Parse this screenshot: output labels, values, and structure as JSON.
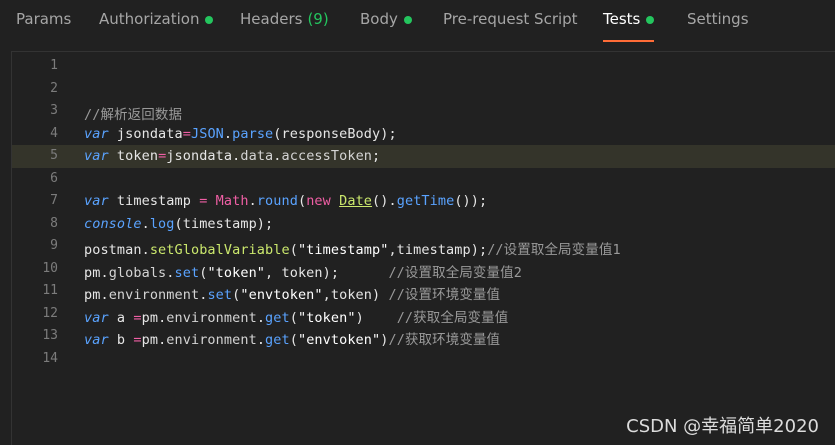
{
  "colors": {
    "active_dot": "#24c55e",
    "active_underline": "#ff6c37",
    "comment": "#9a9a9a",
    "keyword": "#5aa3ff",
    "string": "#ffffff",
    "method": "#cbe86d",
    "property": "#d4d4d4",
    "builtin": "#f05fa5",
    "operator": "#f05fa5"
  },
  "tabs": [
    {
      "label": "Params",
      "count": "",
      "dot": false,
      "active": false
    },
    {
      "label": "Authorization",
      "count": "",
      "dot": true,
      "active": false
    },
    {
      "label": "Headers",
      "count": "(9)",
      "dot": false,
      "active": false
    },
    {
      "label": "Body",
      "count": "",
      "dot": true,
      "active": false
    },
    {
      "label": "Pre-request Script",
      "count": "",
      "dot": false,
      "active": false
    },
    {
      "label": "Tests",
      "count": "",
      "dot": true,
      "active": true
    },
    {
      "label": "Settings",
      "count": "",
      "dot": false,
      "active": false
    }
  ],
  "editor": {
    "lines": [
      {
        "num": "1",
        "highlighted": false,
        "tokens": []
      },
      {
        "num": "2",
        "highlighted": false,
        "tokens": []
      },
      {
        "num": "3",
        "highlighted": false,
        "tokens": [
          {
            "t": "//解析返回数据",
            "c": "#9a9a9a"
          }
        ]
      },
      {
        "num": "4",
        "highlighted": false,
        "tokens": [
          {
            "t": "var",
            "c": "#5aa3ff",
            "k": "kw"
          },
          {
            "t": " jsondata",
            "c": "#e6e6e6"
          },
          {
            "t": "=",
            "c": "#f05fa5"
          },
          {
            "t": "JSON",
            "c": "#5aa3ff"
          },
          {
            "t": ".",
            "c": "#e6e6e6"
          },
          {
            "t": "parse",
            "c": "#5aa3ff"
          },
          {
            "t": "(responseBody);",
            "c": "#e6e6e6"
          }
        ]
      },
      {
        "num": "5",
        "highlighted": true,
        "tokens": [
          {
            "t": "var",
            "c": "#5aa3ff",
            "k": "kw"
          },
          {
            "t": " token",
            "c": "#e6e6e6"
          },
          {
            "t": "=",
            "c": "#f05fa5"
          },
          {
            "t": "jsondata.",
            "c": "#e6e6e6"
          },
          {
            "t": "data",
            "c": "#d4d4d4"
          },
          {
            "t": ".",
            "c": "#e6e6e6"
          },
          {
            "t": "accessToken",
            "c": "#d4d4d4"
          },
          {
            "t": ";",
            "c": "#e6e6e6"
          }
        ]
      },
      {
        "num": "6",
        "highlighted": false,
        "tokens": []
      },
      {
        "num": "7",
        "highlighted": false,
        "tokens": [
          {
            "t": "var",
            "c": "#5aa3ff",
            "k": "kw"
          },
          {
            "t": " timestamp ",
            "c": "#e6e6e6"
          },
          {
            "t": "=",
            "c": "#f05fa5"
          },
          {
            "t": " ",
            "c": "#e6e6e6"
          },
          {
            "t": "Math",
            "c": "#f05fa5"
          },
          {
            "t": ".",
            "c": "#e6e6e6"
          },
          {
            "t": "round",
            "c": "#5aa3ff"
          },
          {
            "t": "(",
            "c": "#e6e6e6"
          },
          {
            "t": "new",
            "c": "#f05fa5"
          },
          {
            "t": " ",
            "c": "#e6e6e6"
          },
          {
            "t": "Date",
            "c": "#cbe86d",
            "k": "ul"
          },
          {
            "t": "().",
            "c": "#e6e6e6"
          },
          {
            "t": "getTime",
            "c": "#5aa3ff"
          },
          {
            "t": "());",
            "c": "#e6e6e6"
          }
        ]
      },
      {
        "num": "8",
        "highlighted": false,
        "tokens": [
          {
            "t": "console",
            "c": "#5aa3ff",
            "k": "kw"
          },
          {
            "t": ".",
            "c": "#e6e6e6"
          },
          {
            "t": "log",
            "c": "#5aa3ff"
          },
          {
            "t": "(timestamp);",
            "c": "#e6e6e6"
          }
        ]
      },
      {
        "num": "9",
        "highlighted": false,
        "tokens": [
          {
            "t": "postman.",
            "c": "#e6e6e6"
          },
          {
            "t": "setGlobalVariable",
            "c": "#cbe86d"
          },
          {
            "t": "(",
            "c": "#e6e6e6"
          },
          {
            "t": "\"timestamp\"",
            "c": "#ffffff"
          },
          {
            "t": ",timestamp);",
            "c": "#e6e6e6"
          },
          {
            "t": "//设置取全局变量值1",
            "c": "#9a9a9a"
          }
        ]
      },
      {
        "num": "10",
        "highlighted": false,
        "tokens": [
          {
            "t": "pm.",
            "c": "#e6e6e6"
          },
          {
            "t": "globals",
            "c": "#d4d4d4"
          },
          {
            "t": ".",
            "c": "#e6e6e6"
          },
          {
            "t": "set",
            "c": "#5aa3ff"
          },
          {
            "t": "(",
            "c": "#e6e6e6"
          },
          {
            "t": "\"token\"",
            "c": "#ffffff"
          },
          {
            "t": ", token);      ",
            "c": "#e6e6e6"
          },
          {
            "t": "//设置取全局变量值2",
            "c": "#9a9a9a"
          }
        ]
      },
      {
        "num": "11",
        "highlighted": false,
        "tokens": [
          {
            "t": "pm.",
            "c": "#e6e6e6"
          },
          {
            "t": "environment",
            "c": "#d4d4d4"
          },
          {
            "t": ".",
            "c": "#e6e6e6"
          },
          {
            "t": "set",
            "c": "#5aa3ff"
          },
          {
            "t": "(",
            "c": "#e6e6e6"
          },
          {
            "t": "\"envtoken\"",
            "c": "#ffffff"
          },
          {
            "t": ",token) ",
            "c": "#e6e6e6"
          },
          {
            "t": "//设置环境变量值",
            "c": "#9a9a9a"
          }
        ]
      },
      {
        "num": "12",
        "highlighted": false,
        "tokens": [
          {
            "t": "var",
            "c": "#5aa3ff",
            "k": "kw"
          },
          {
            "t": " a ",
            "c": "#e6e6e6"
          },
          {
            "t": "=",
            "c": "#f05fa5"
          },
          {
            "t": "pm.",
            "c": "#e6e6e6"
          },
          {
            "t": "environment",
            "c": "#d4d4d4"
          },
          {
            "t": ".",
            "c": "#e6e6e6"
          },
          {
            "t": "get",
            "c": "#5aa3ff"
          },
          {
            "t": "(",
            "c": "#e6e6e6"
          },
          {
            "t": "\"token\"",
            "c": "#ffffff"
          },
          {
            "t": ")    ",
            "c": "#e6e6e6"
          },
          {
            "t": "//获取全局变量值",
            "c": "#9a9a9a"
          }
        ]
      },
      {
        "num": "13",
        "highlighted": false,
        "tokens": [
          {
            "t": "var",
            "c": "#5aa3ff",
            "k": "kw"
          },
          {
            "t": " b ",
            "c": "#e6e6e6"
          },
          {
            "t": "=",
            "c": "#f05fa5"
          },
          {
            "t": "pm.",
            "c": "#e6e6e6"
          },
          {
            "t": "environment",
            "c": "#d4d4d4"
          },
          {
            "t": ".",
            "c": "#e6e6e6"
          },
          {
            "t": "get",
            "c": "#5aa3ff"
          },
          {
            "t": "(",
            "c": "#e6e6e6"
          },
          {
            "t": "\"envtoken\"",
            "c": "#ffffff"
          },
          {
            "t": ")",
            "c": "#e6e6e6"
          },
          {
            "t": "//获取环境变量值",
            "c": "#9a9a9a"
          }
        ]
      },
      {
        "num": "14",
        "highlighted": false,
        "tokens": []
      }
    ]
  },
  "watermark": "CSDN @幸福简单2020"
}
